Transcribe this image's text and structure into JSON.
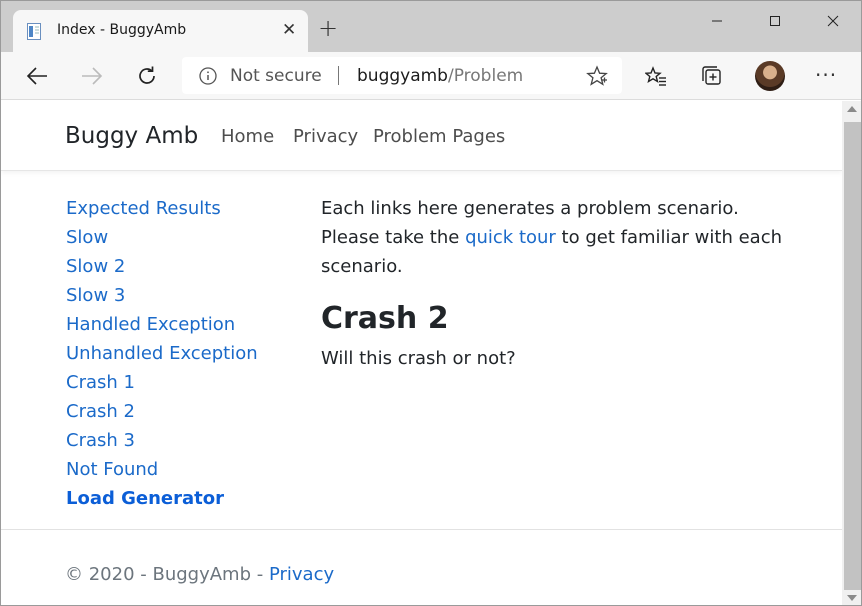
{
  "browser": {
    "tab_title": "Index - BuggyAmb",
    "not_secure_label": "Not secure",
    "url_host": "buggyamb",
    "url_path": "/Problem"
  },
  "site": {
    "brand": "Buggy Amb",
    "nav": [
      {
        "label": "Home"
      },
      {
        "label": "Privacy"
      },
      {
        "label": "Problem Pages"
      }
    ]
  },
  "sidebar": {
    "links": [
      {
        "label": "Expected Results"
      },
      {
        "label": "Slow"
      },
      {
        "label": "Slow 2"
      },
      {
        "label": "Slow 3"
      },
      {
        "label": "Handled Exception"
      },
      {
        "label": "Unhandled Exception"
      },
      {
        "label": "Crash 1"
      },
      {
        "label": "Crash 2"
      },
      {
        "label": "Crash 3"
      },
      {
        "label": "Not Found"
      },
      {
        "label": "Load Generator"
      }
    ]
  },
  "main": {
    "intro_before": "Each links here generates a problem scenario. Please take the ",
    "intro_link": "quick tour",
    "intro_after": " to get familiar with each scenario.",
    "heading": "Crash 2",
    "question": "Will this crash or not?"
  },
  "footer": {
    "text": "© 2020 - BuggyAmb - ",
    "privacy_link": "Privacy"
  },
  "colors": {
    "link": "#1b6ac9",
    "text": "#212529",
    "muted": "#6c757d"
  }
}
